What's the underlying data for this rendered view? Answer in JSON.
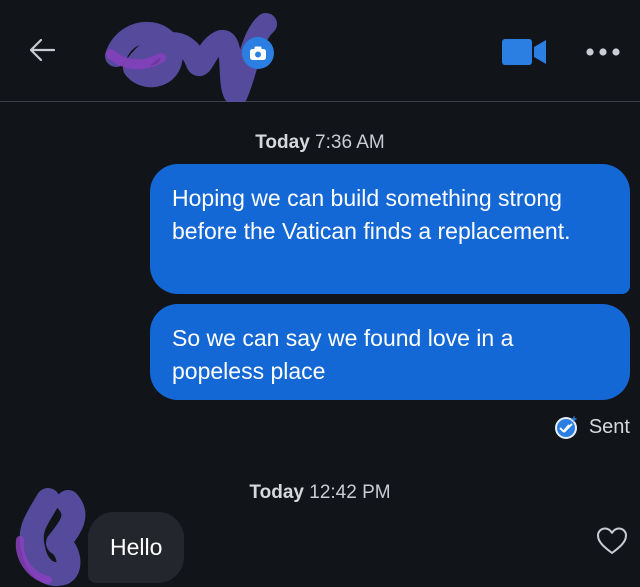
{
  "header": {
    "back_icon": "arrow-left-icon",
    "camera_icon": "camera-icon",
    "video_icon": "video-call-icon",
    "more_icon": "more-dots-icon"
  },
  "messages": [
    {
      "timestamp_day": "Today",
      "timestamp_time": "7:36 AM"
    }
  ],
  "outgoing": [
    {
      "text": "Hoping we can build something strong before the Vatican finds a replacement."
    },
    {
      "text": "So we can say we found love in a popeless place"
    }
  ],
  "status": {
    "label": "Sent"
  },
  "second_group": {
    "timestamp_day": "Today",
    "timestamp_time": "12:42 PM"
  },
  "incoming": [
    {
      "text": "Hello"
    }
  ],
  "colors": {
    "background": "#111419",
    "outgoing_bubble": "#1468d6",
    "incoming_bubble": "#23262d",
    "accent": "#2c7fe2",
    "scribble": "#5b4fa6"
  }
}
